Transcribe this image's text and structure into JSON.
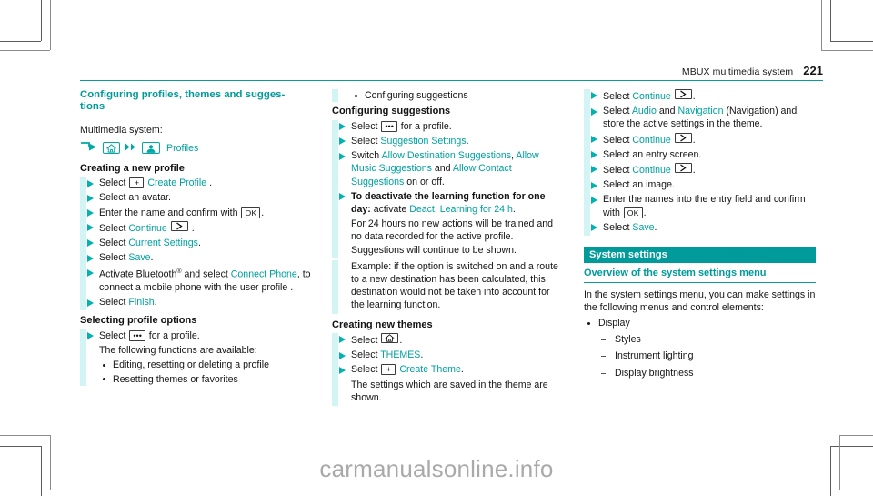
{
  "header": {
    "title": "MBUX multimedia system",
    "page_number": "221"
  },
  "colors": {
    "teal": "#009a9a",
    "teal_bright": "#00b2b2",
    "gutter": "#d2f4f4",
    "text": "#141414",
    "watermark": "#a9a9a9"
  },
  "watermark": "carmanualsonline.info",
  "icons": {
    "arrow_path": "arrow-path-icon",
    "home": "home-icon",
    "double_chevron": "double-chevron-right-icon",
    "profile": "profile-avatar-icon",
    "plus_key": "plus-key-icon",
    "ok_key": "ok-key-icon",
    "chevron_key": "chevron-right-key-icon",
    "ellipsis_key": "ellipsis-key-icon"
  },
  "left_column": {
    "title": "Configuring profiles, themes and sugges-\ntions",
    "title_line1": "Configuring profiles, themes and sugges-",
    "title_line2": "tions",
    "intro": "Multimedia system:",
    "path": {
      "label": "Profiles"
    },
    "section_creating": "Creating a new profile",
    "steps_creating": [
      {
        "pre": "Select ",
        "key": "plus",
        "mid": "",
        "link": "Create Profile",
        "post": " ."
      },
      {
        "pre": "Select an avatar.",
        "key": "",
        "mid": "",
        "link": "",
        "post": ""
      },
      {
        "pre": "Enter the name and confirm with ",
        "key": "ok",
        "mid": "",
        "link": "",
        "post": "."
      },
      {
        "pre": "Select ",
        "key": "",
        "mid": "",
        "link": "Continue",
        "keyafter": "chevron",
        "post": " ."
      },
      {
        "pre": "Select ",
        "key": "",
        "mid": "",
        "link": "Current Settings",
        "post": "."
      },
      {
        "pre": "Select ",
        "key": "",
        "mid": "",
        "link": "Save",
        "post": "."
      }
    ],
    "step_bluetooth": {
      "a": "Activate Bluetooth",
      "sup": "®",
      "b": " and select ",
      "link": "Connect Phone",
      "c": ", to connect a mobile phone with the user profile ."
    },
    "step_finish": {
      "pre": "Select ",
      "link": "Finish",
      "post": "."
    },
    "section_options": "Selecting profile options",
    "step_options": {
      "pre": "Select ",
      "key": "ellipsis",
      "post": " for a profile."
    },
    "options_note": "The following functions are available:",
    "options_bullets": [
      "Editing, resetting or deleting a profile",
      "Resetting themes or favorites"
    ]
  },
  "middle_column": {
    "top_bullet": "Configuring suggestions",
    "section_suggestions": "Configuring suggestions",
    "step_select_ellipsis": {
      "pre": "Select ",
      "key": "ellipsis",
      "post": " for a profile."
    },
    "step_suggestion_settings": {
      "pre": "Select ",
      "link": "Suggestion Settings",
      "post": "."
    },
    "step_switch": {
      "pre": "Switch ",
      "link1": "Allow Destination Suggestions",
      "sep1": ", ",
      "link2": "Allow Music Suggestions",
      "sep2": " and ",
      "link3": "Allow Contact Suggestions",
      "post": " on or off."
    },
    "step_deactivate": {
      "bold": "To deactivate the learning function for one day:",
      "mid": " activate ",
      "link": "Deact. Learning for 24 h",
      "post": "."
    },
    "deactivate_note": "For 24 hours no new actions will be trained and no data recorded for the active profile. Suggestions will continue to be shown.",
    "deactivate_example": "Example: if the option is switched on and a route to a new destination has been calculated, this destination would not be taken into account for the learning function.",
    "section_themes": "Creating new themes",
    "steps_themes": [
      {
        "pre": "Select ",
        "key": "home",
        "post": "."
      },
      {
        "pre": "Select ",
        "link": "THEMES",
        "post": "."
      },
      {
        "pre": "Select ",
        "key": "plus",
        "link": "Create Theme",
        "post": "."
      }
    ],
    "themes_note": "The settings which are saved in the theme are shown."
  },
  "right_column": {
    "steps": [
      {
        "pre": "Select ",
        "link": "Continue",
        "keyafter": "chevron",
        "post": "."
      },
      {
        "pre": "Select ",
        "link": "Audio",
        "mid": " and ",
        "link2": "Navigation",
        "post": " (Navigation) and store the active settings in the theme."
      },
      {
        "pre": "Select ",
        "link": "Continue",
        "keyafter": "chevron",
        "post": "."
      },
      {
        "pre": "Select an entry screen.",
        "post": ""
      },
      {
        "pre": "Select ",
        "link": "Continue",
        "keyafter": "chevron",
        "post": "."
      },
      {
        "pre": "Select an image.",
        "post": ""
      },
      {
        "pre": "Enter the names into the entry field and confirm with ",
        "keyafter": "ok",
        "post": "."
      },
      {
        "pre": "Select ",
        "link": "Save",
        "post": "."
      }
    ],
    "section_bar": "System settings",
    "subhead": "Overview of the system settings menu",
    "intro": "In the system settings menu, you can make settings in the following menus and control elements:",
    "bullets": [
      {
        "label": "Display",
        "sub": [
          "Styles",
          "Instrument lighting",
          "Display brightness"
        ]
      }
    ]
  }
}
